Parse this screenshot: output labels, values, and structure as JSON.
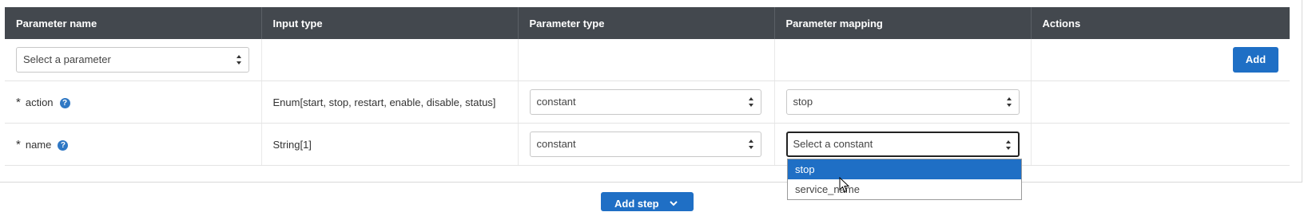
{
  "table": {
    "headers": [
      "Parameter name",
      "Input type",
      "Parameter type",
      "Parameter mapping",
      "Actions"
    ]
  },
  "add_row": {
    "parameter_select": "Select a parameter",
    "add_button": "Add"
  },
  "rows": [
    {
      "required_mark": "*",
      "name": "action",
      "help": "?",
      "input_type": "Enum[start, stop, restart, enable, disable, status]",
      "parameter_type": "constant",
      "parameter_mapping": "stop"
    },
    {
      "required_mark": "*",
      "name": "name",
      "help": "?",
      "input_type": "String[1]",
      "parameter_type": "constant",
      "parameter_mapping": "Select a constant"
    }
  ],
  "dropdown": {
    "options": [
      "stop",
      "service_name"
    ],
    "highlighted": "stop"
  },
  "footer": {
    "add_step_label": "Add step"
  },
  "colors": {
    "header_bg": "#43484e",
    "accent": "#1f6fc5"
  }
}
